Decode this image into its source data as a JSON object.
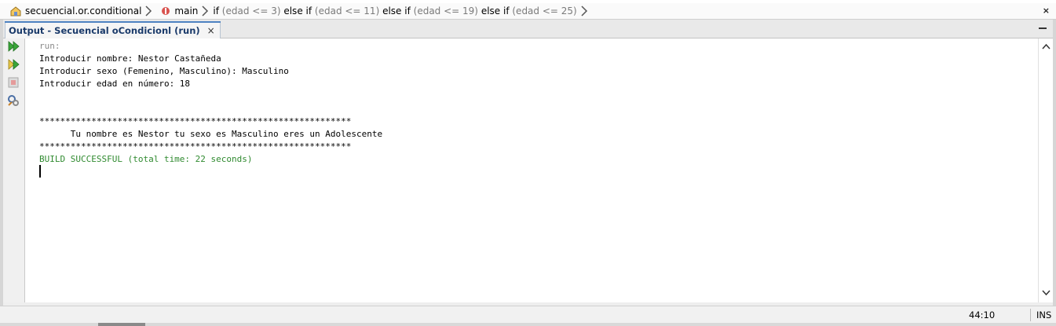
{
  "breadcrumb": {
    "class_name": "secuencial.or.conditional",
    "method_name": "main",
    "conditions": [
      {
        "keyword": "if",
        "cond": "(edad <= 3)"
      },
      {
        "keyword": "else if",
        "cond": "(edad <= 11)"
      },
      {
        "keyword": "else if",
        "cond": "(edad <= 19)"
      },
      {
        "keyword": "else if",
        "cond": "(edad <= 25)"
      }
    ],
    "close_label": "×"
  },
  "output_tab": {
    "title": "Output - Secuencial oCondicionl (run)",
    "close_label": "×"
  },
  "toolbar": {
    "icons": [
      "rerun-icon",
      "rerun-with-options-icon",
      "stop-icon",
      "settings-icon"
    ]
  },
  "console": {
    "lines": [
      "run:",
      "Introducir nombre: Nestor Castañeda",
      "Introducir sexo (Femenino, Masculino): Masculino",
      "Introducir edad en número: 18",
      "",
      "",
      "************************************************************",
      "      Tu nombre es Nestor tu sexo es Masculino eres un Adolescente",
      "************************************************************",
      "BUILD SUCCESSFUL (total time: 22 seconds)"
    ]
  },
  "status_bar": {
    "position": "44:10",
    "mode": "INS"
  },
  "colors": {
    "success": "#2f8a2f",
    "muted": "#8a8a8a",
    "tab_accent": "#4e82c2"
  }
}
